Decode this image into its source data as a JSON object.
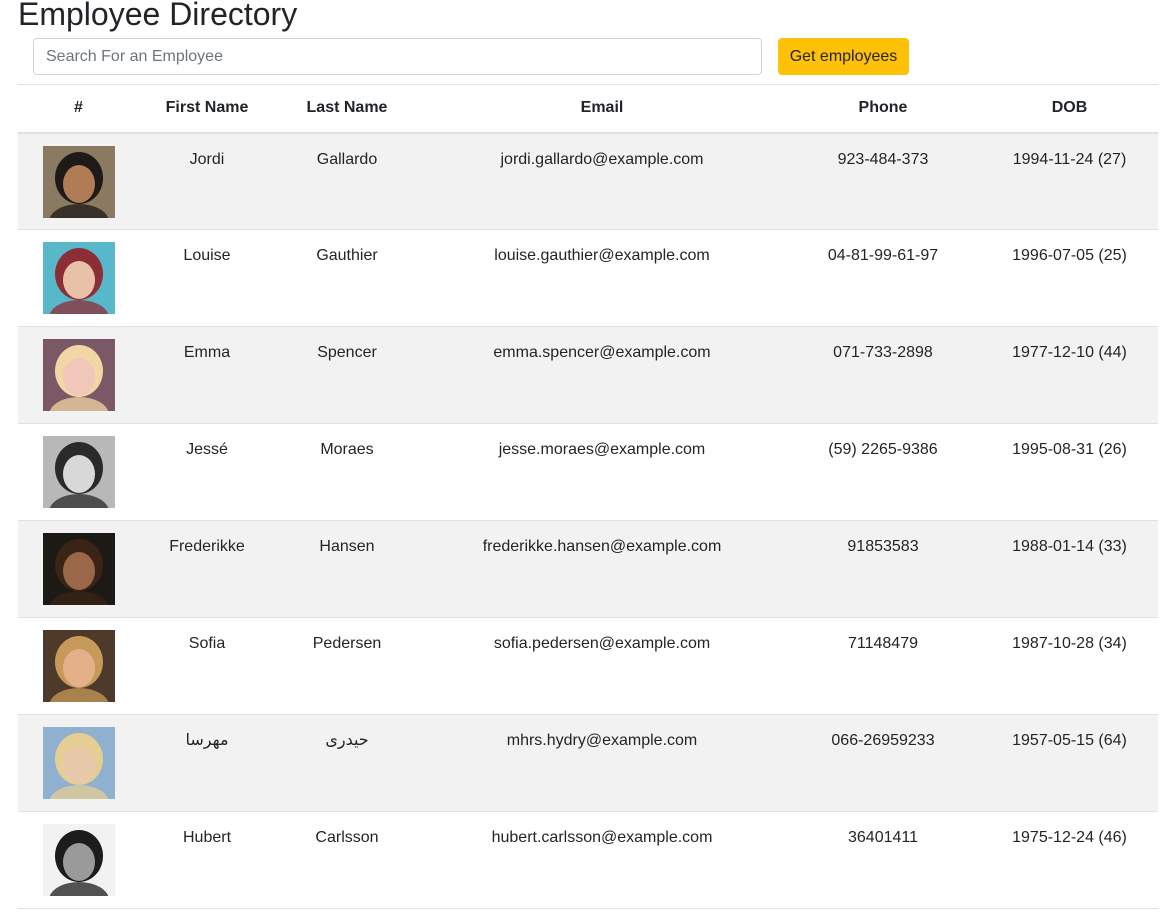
{
  "page": {
    "title": "Employee Directory"
  },
  "search": {
    "placeholder": "Search For an Employee",
    "value": ""
  },
  "actions": {
    "get_employees_label": "Get employees",
    "accent_color": "#ffc107"
  },
  "table": {
    "columns": [
      "#",
      "First Name",
      "Last Name",
      "Email",
      "Phone",
      "DOB"
    ],
    "rows": [
      {
        "avatar": {
          "icon": "photo-icon",
          "bg": "#8a7a62",
          "skin": "#b07c55",
          "hair": "#1e1a17"
        },
        "first": "Jordi",
        "last": "Gallardo",
        "email": "jordi.gallardo@example.com",
        "phone": "923-484-373",
        "dob": "1994-11-24 (27)"
      },
      {
        "avatar": {
          "icon": "photo-icon",
          "bg": "#58b7c9",
          "skin": "#e7c2a8",
          "hair": "#8c2e35"
        },
        "first": "Louise",
        "last": "Gauthier",
        "email": "louise.gauthier@example.com",
        "phone": "04-81-99-61-97",
        "dob": "1996-07-05 (25)"
      },
      {
        "avatar": {
          "icon": "photo-icon",
          "bg": "#7a5866",
          "skin": "#f0c7b8",
          "hair": "#f3d6a5"
        },
        "first": "Emma",
        "last": "Spencer",
        "email": "emma.spencer@example.com",
        "phone": "071-733-2898",
        "dob": "1977-12-10 (44)"
      },
      {
        "avatar": {
          "icon": "photo-icon",
          "bg": "#b8b8b8",
          "skin": "#d8d8d8",
          "hair": "#2a2a2a"
        },
        "first": "Jessé",
        "last": "Moraes",
        "email": "jesse.moraes@example.com",
        "phone": "(59) 2265-9386",
        "dob": "1995-08-31 (26)"
      },
      {
        "avatar": {
          "icon": "photo-icon",
          "bg": "#1d1a16",
          "skin": "#9a6848",
          "hair": "#3a2416"
        },
        "first": "Frederikke",
        "last": "Hansen",
        "email": "frederikke.hansen@example.com",
        "phone": "91853583",
        "dob": "1988-01-14 (33)"
      },
      {
        "avatar": {
          "icon": "photo-icon",
          "bg": "#4d3a2a",
          "skin": "#e3b08a",
          "hair": "#c79a59"
        },
        "first": "Sofia",
        "last": "Pedersen",
        "email": "sofia.pedersen@example.com",
        "phone": "71148479",
        "dob": "1987-10-28 (34)"
      },
      {
        "avatar": {
          "icon": "photo-icon",
          "bg": "#8fb0cf",
          "skin": "#e8c9aa",
          "hair": "#e6cd94"
        },
        "first": "مهرسا",
        "last": "حیدری",
        "email": "mhrs.hydry@example.com",
        "phone": "066-26959233",
        "dob": "1957-05-15 (64)"
      },
      {
        "avatar": {
          "icon": "photo-icon",
          "bg": "#f2f2f2",
          "skin": "#9a9a9a",
          "hair": "#1c1c1c"
        },
        "first": "Hubert",
        "last": "Carlsson",
        "email": "hubert.carlsson@example.com",
        "phone": "36401411",
        "dob": "1975-12-24 (46)"
      }
    ]
  }
}
